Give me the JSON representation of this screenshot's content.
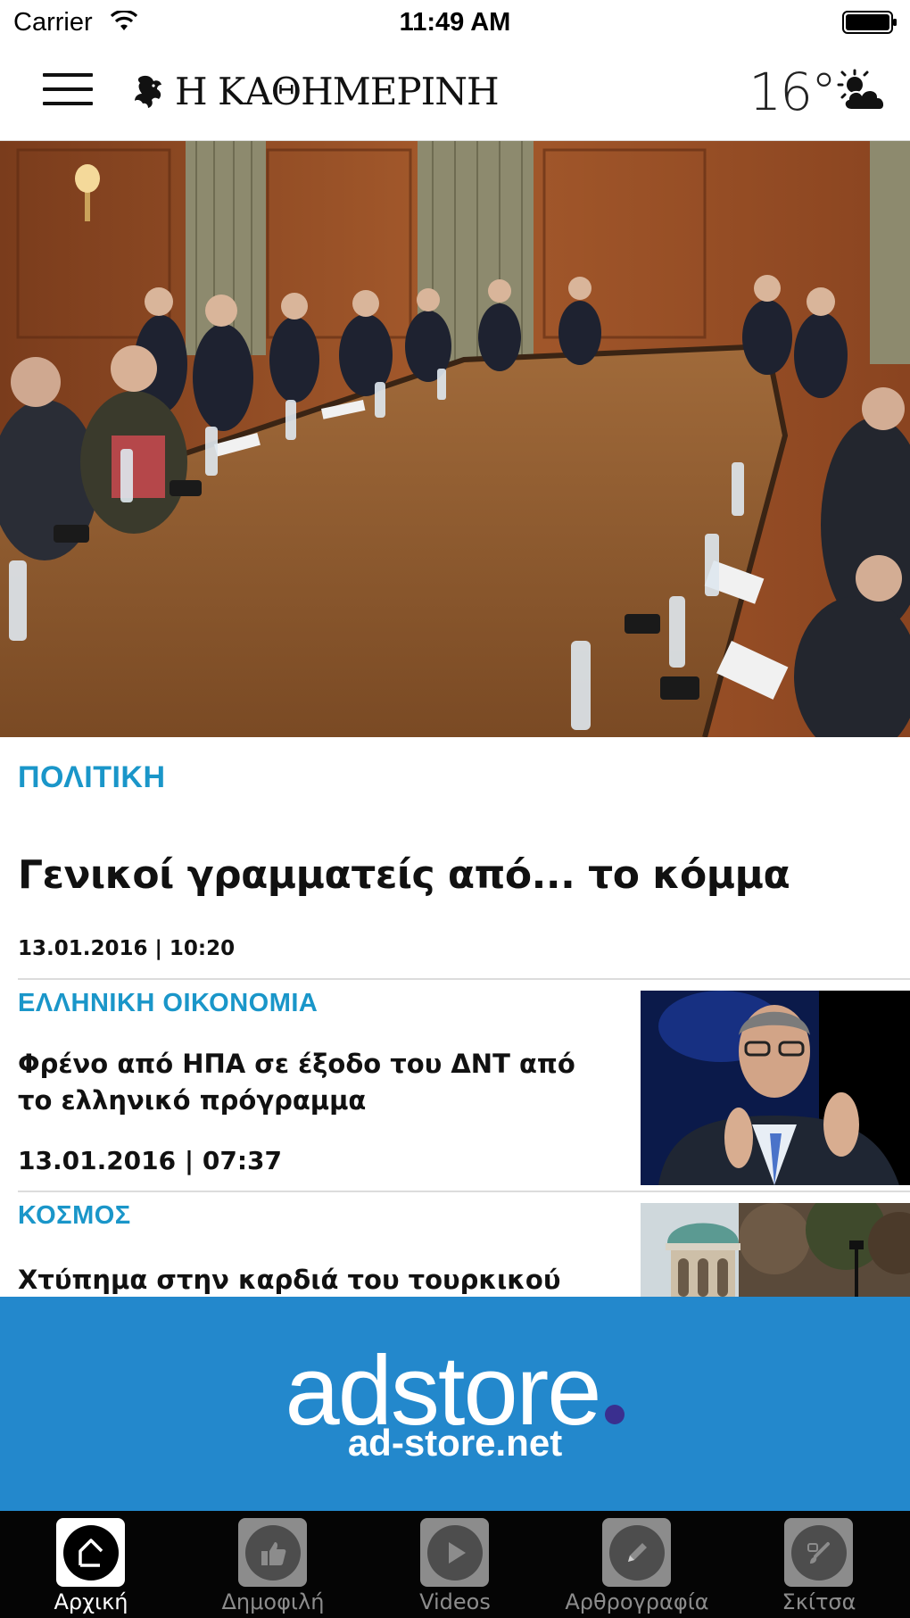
{
  "status_bar": {
    "carrier": "Carrier",
    "time": "11:49 AM"
  },
  "header": {
    "logo_text": "Η ΚΑΘΗΜΕΡΙΝΗ",
    "temperature": "16°",
    "weather_icon": "partly-cloudy-icon"
  },
  "hero": {
    "category": "ΠΟΛΙΤΙΚΗ",
    "title": "Γενικοί γραμματείς από... το κόμμα",
    "meta": "13.01.2016 | 10:20"
  },
  "articles": [
    {
      "category": "ΕΛΛΗΝΙΚΗ ΟΙΚΟΝΟΜΙΑ",
      "title": "Φρένο από ΗΠΑ σε έξοδο του ΔΝΤ από το ελληνικό πρόγραμμα",
      "meta": "13.01.2016 | 07:37"
    },
    {
      "category": "ΚΟΣΜΟΣ",
      "title": "Χτύπημα στην καρδιά του τουρκικού"
    }
  ],
  "ad": {
    "brand": "adstore",
    "url": "ad-store.net",
    "background": "#2388cc"
  },
  "tabs": [
    {
      "label": "Αρχική",
      "icon": "home-icon",
      "active": true
    },
    {
      "label": "Δημοφιλή",
      "icon": "thumbs-up-icon",
      "active": false
    },
    {
      "label": "Videos",
      "icon": "play-icon",
      "active": false
    },
    {
      "label": "Αρθρογραφία",
      "icon": "pencil-icon",
      "active": false
    },
    {
      "label": "Σκίτσα",
      "icon": "brush-icon",
      "active": false
    }
  ],
  "colors": {
    "accent": "#1a96c9",
    "tab_bar": "#050505"
  }
}
